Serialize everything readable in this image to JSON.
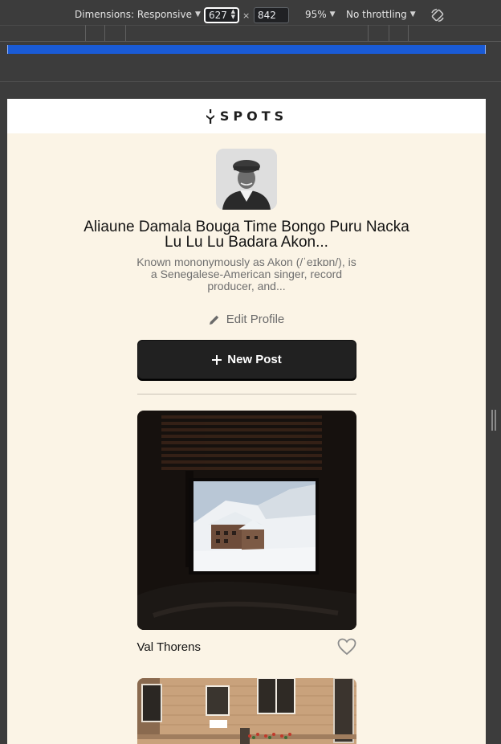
{
  "devtools": {
    "dimensions_label": "Dimensions: Responsive",
    "width_value": "627",
    "times_symbol": "×",
    "height_value": "842",
    "zoom_label": "95%",
    "throttling_label": "No throttling",
    "media_bar_color": "#1a5bd6"
  },
  "site": {
    "logo_text": "SPOTS"
  },
  "profile": {
    "name": "Aliaune Damala Bouga Time Bongo Puru Nacka Lu Lu Lu Badara Akon...",
    "bio": "Known mononymously as Akon (/ˈeɪkɒn/), is a Senegalese-American singer, record producer, and...",
    "edit_label": "Edit Profile",
    "new_post_label": "New Post"
  },
  "cards": [
    {
      "title": "Val Thorens",
      "liked": false,
      "image": "window-snow-village"
    },
    {
      "title": "",
      "image": "paris-building"
    }
  ],
  "icons": {
    "edit": "pencil-icon",
    "add": "plus-icon",
    "like": "heart-icon",
    "rotate": "rotate-icon"
  }
}
